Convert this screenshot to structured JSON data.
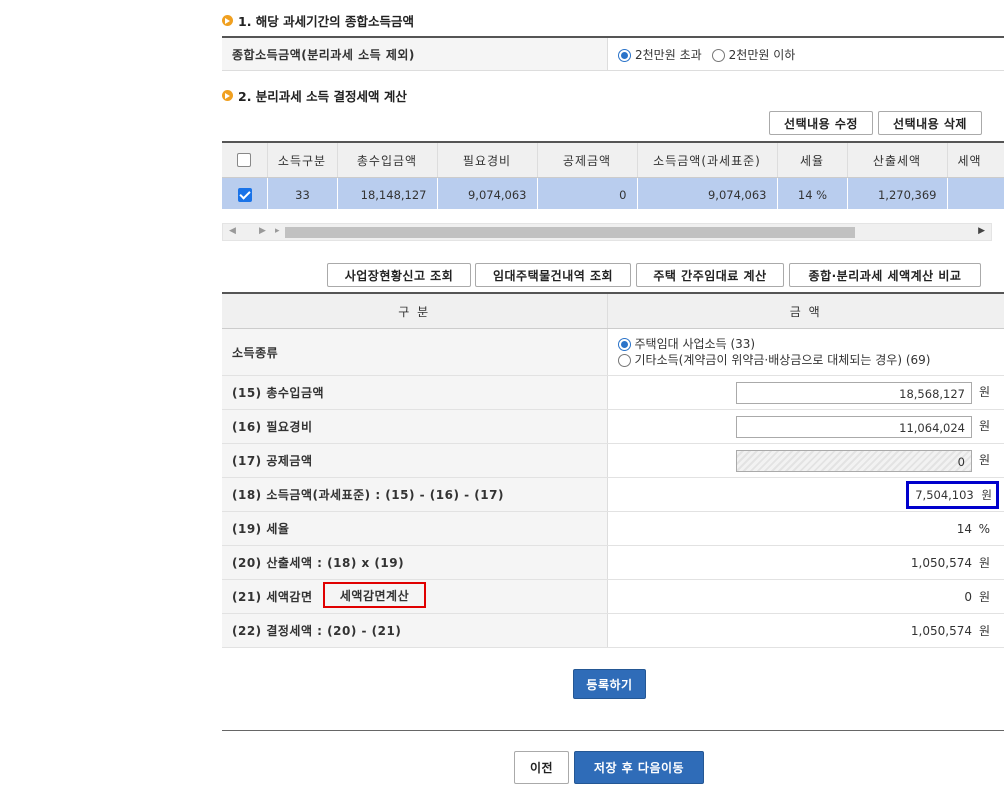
{
  "section1": {
    "title": "1. 해당 과세기간의 종합소득금액",
    "row_label": "종합소득금액(분리과세 소득 제외)",
    "options": [
      "2천만원 초과",
      "2천만원 이하"
    ],
    "selected": "2천만원 초과"
  },
  "section2": {
    "title": "2. 분리과세 소득 결정세액 계산",
    "edit_button": "선택내용 수정",
    "delete_button": "선택내용 삭제",
    "table": {
      "headers": [
        "소득구분",
        "총수입금액",
        "필요경비",
        "공제금액",
        "소득금액(과세표준)",
        "세율",
        "산출세액",
        "세액"
      ],
      "rows": [
        {
          "checked": true,
          "cells": [
            "33",
            "18,148,127",
            "9,074,063",
            "0",
            "9,074,063",
            "14 %",
            "1,270,369",
            ""
          ]
        }
      ]
    }
  },
  "action_buttons": [
    "사업장현황신고 조회",
    "임대주택물건내역 조회",
    "주택 간주임대료 계산",
    "종합·분리과세 세액계산 비교"
  ],
  "calc": {
    "header_col1": "구 분",
    "header_col2": "금 액",
    "income_type_label": "소득종류",
    "income_type_options": [
      "주택임대 사업소득 (33)",
      "기타소득(계약금이 위약금·배상금으로 대체되는 경우) (69)"
    ],
    "income_type_selected": "주택임대 사업소득 (33)",
    "rows": [
      {
        "label": "(15) 총수입금액",
        "value": "18,568,127",
        "unit": "원"
      },
      {
        "label": "(16) 필요경비",
        "value": "11,064,024",
        "unit": "원"
      },
      {
        "label": "(17) 공제금액",
        "value": "0",
        "unit": "원"
      },
      {
        "label": "(18) 소득금액(과세표준) : (15) - (16) - (17)",
        "value": "7,504,103",
        "unit": "원"
      },
      {
        "label": "(19) 세율",
        "value": "14",
        "unit": "%"
      },
      {
        "label": "(20) 산출세액 : (18) x (19)",
        "value": "1,050,574",
        "unit": "원"
      },
      {
        "label": "(21) 세액감면",
        "value": "0",
        "unit": "원",
        "button": "세액감면계산"
      },
      {
        "label": "(22) 결정세액 : (20) - (21)",
        "value": "1,050,574",
        "unit": "원"
      }
    ]
  },
  "register_button": "등록하기",
  "prev_button": "이전",
  "save_next_button": "저장 후 다음이동",
  "colors": {
    "highlight_blue": "#0000cc",
    "highlight_red": "#e00000",
    "selected_row": "#b9cdee",
    "button_blue": "#2f6cb8"
  }
}
